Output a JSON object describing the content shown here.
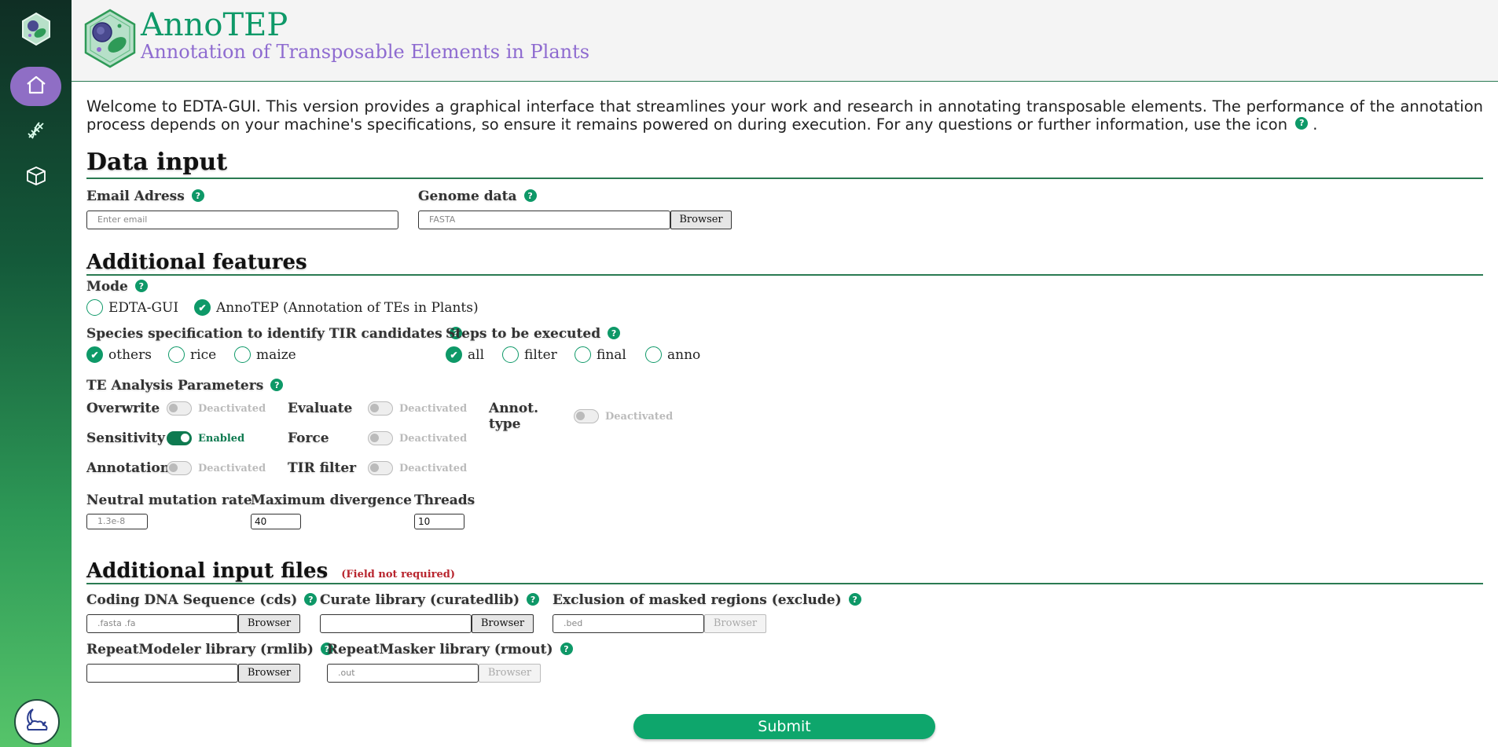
{
  "app": {
    "title": "AnnoTEP",
    "subtitle": "Annotation of Transposable Elements in Plants",
    "accent": "#0e9968",
    "purple": "#8e6bd0"
  },
  "sidebar": {
    "items": [
      {
        "name": "home",
        "icon": "home-icon",
        "active": true
      },
      {
        "name": "dna",
        "icon": "dna-icon",
        "active": false
      },
      {
        "name": "package",
        "icon": "box-icon",
        "active": false
      }
    ],
    "theme_icon": "moon-cloud-icon"
  },
  "welcome": {
    "text": "Welcome to EDTA-GUI. This version provides a graphical interface that streamlines your work and research in annotating transposable elements. The performance of the annotation process depends on your machine's specifications, so ensure it remains powered on during execution. For any questions or further information, use the icon",
    "tail": "."
  },
  "help_symbol": "?",
  "data_input": {
    "heading": "Data input",
    "email": {
      "label": "Email Adress",
      "placeholder": "Enter email"
    },
    "genome": {
      "label": "Genome data",
      "placeholder": "FASTA",
      "button": "Browser"
    }
  },
  "additional_features": {
    "heading": "Additional features",
    "mode": {
      "label": "Mode",
      "options": [
        "EDTA-GUI",
        "AnnoTEP (Annotation of TEs in Plants)"
      ],
      "selected": "AnnoTEP (Annotation of TEs in Plants)"
    },
    "species": {
      "label": "Species specification to identify TIR candidates",
      "options": [
        "others",
        "rice",
        "maize"
      ],
      "selected": "others"
    },
    "steps": {
      "label": "Steps to be executed",
      "options": [
        "all",
        "filter",
        "final",
        "anno"
      ],
      "selected": "all"
    },
    "te_params": {
      "label": "TE Analysis Parameters",
      "toggles": [
        {
          "name": "Overwrite",
          "state": "Deactivated",
          "on": false
        },
        {
          "name": "Evaluate",
          "state": "Deactivated",
          "on": false
        },
        {
          "name": "Annot. type",
          "state": "Deactivated",
          "on": false
        },
        {
          "name": "Sensitivity",
          "state": "Enabled",
          "on": true
        },
        {
          "name": "Force",
          "state": "Deactivated",
          "on": false
        },
        {
          "name": "Annotation",
          "state": "Deactivated",
          "on": false
        },
        {
          "name": "TIR filter",
          "state": "Deactivated",
          "on": false
        }
      ]
    },
    "neutral_rate": {
      "label": "Neutral mutation rate",
      "placeholder": "1.3e-8"
    },
    "max_divergence": {
      "label": "Maximum divergence",
      "value": "40"
    },
    "threads": {
      "label": "Threads",
      "value": "10"
    }
  },
  "additional_files": {
    "heading": "Additional input files",
    "note": "(Field not required)",
    "cds": {
      "label": "Coding DNA Sequence (cds)",
      "placeholder": ".fasta .fa",
      "button": "Browser"
    },
    "curatedlib": {
      "label": "Curate library (curatedlib)",
      "placeholder": "",
      "button": "Browser"
    },
    "exclude": {
      "label": "Exclusion of masked regions (exclude)",
      "placeholder": ".bed",
      "button": "Browser"
    },
    "rmlib": {
      "label": "RepeatModeler library (rmlib)",
      "placeholder": "",
      "button": "Browser"
    },
    "rmout": {
      "label": "RepeatMasker library (rmout)",
      "placeholder": ".out",
      "button": "Browser"
    }
  },
  "submit": {
    "label": "Submit"
  }
}
